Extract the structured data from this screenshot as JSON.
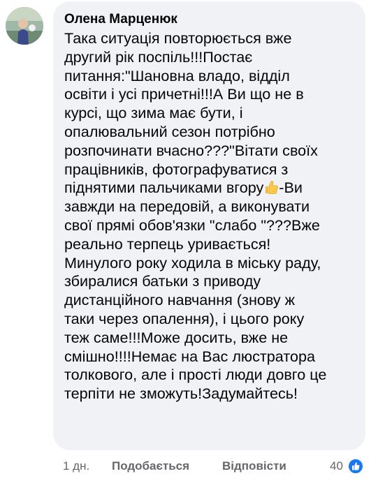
{
  "comment": {
    "author": "Олена Марценюк",
    "lines": [
      "Така ситуація повторюється вже",
      "другий рік поспіль!!!Постає",
      "питання:\"Шановна владо, відділ",
      "освіти і усі причетні!!!А Ви що не в",
      "курсі, що зима має бути, і",
      "опалювальний сезон потрібно",
      "розпочинати вчасно???\"Вітати своїх",
      "працівників, фотографуватися з",
      "піднятими пальчиками вгору",
      "завжди на передовій, а виконувати",
      "свої прямі обов'язки \"слабо \"???Вже",
      "реально терпець уривається!",
      "Минулого року ходила в міську раду,",
      "збиралися батьки з приводу",
      "дистанційного навчання (знову ж",
      "таки через опалення), і цього року",
      "теж саме!!!Може досить, вже не",
      "смішно!!!!Немає на Вас люстратора",
      "толкового, але і прості люди довго це",
      "терпіти не зможуть!Задумайтесь!"
    ],
    "line9_suffix": "-Ви"
  },
  "actions": {
    "time": "1 дн.",
    "like": "Подобається",
    "reply": "Відповісти"
  },
  "reactions": {
    "count": "40",
    "icon": "like-reaction-icon",
    "color": "#1877f2"
  }
}
